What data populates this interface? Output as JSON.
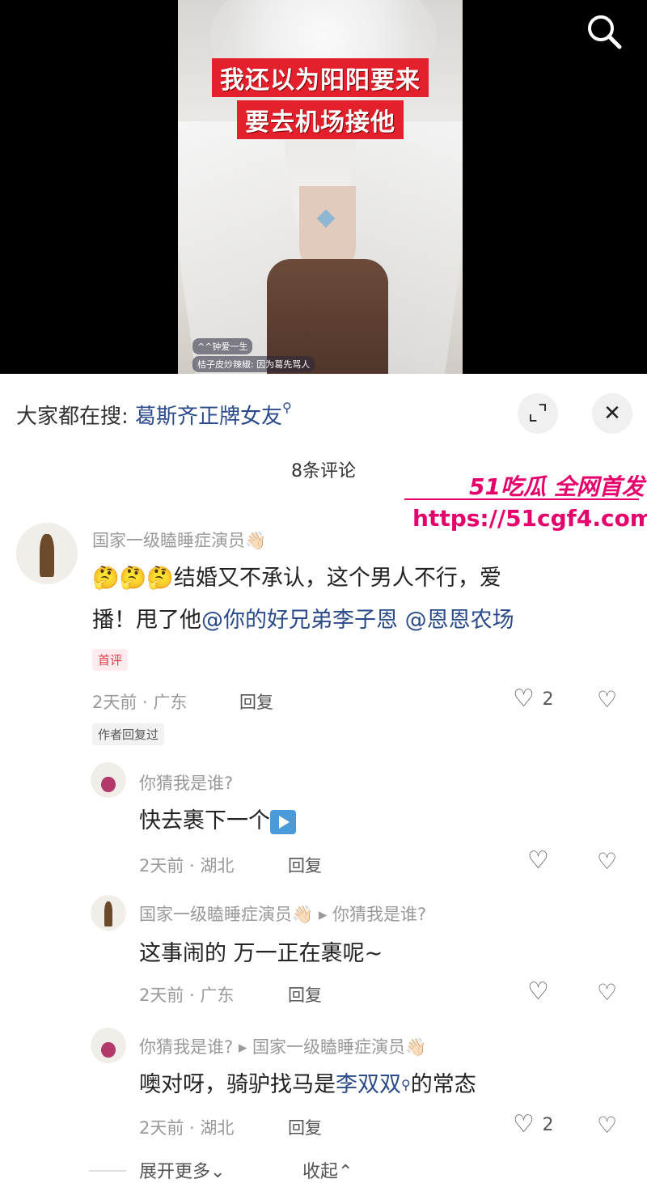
{
  "video": {
    "caption_line1": "我还以为阳阳要来",
    "caption_line2": "要去机场接他",
    "live_msg1": "^^钟爱一生",
    "live_msg2": "桔子皮炒辣椒: 因为葛先骂人"
  },
  "search_bar": {
    "prefix": "大家都在搜:",
    "query": "葛斯齐正牌女友",
    "query_icon": "search-icon",
    "expand_icon": "expand-icon",
    "close_icon": "close-icon"
  },
  "comment_count": "8条评论",
  "watermark": {
    "brand": "51吃瓜 全网首发",
    "url": "https://51cgf4.com"
  },
  "comments": [
    {
      "name": "国家一级瞌睡症演员👋🏻",
      "text_pre": "🤔🤔🤔结婚又不承认，这个男人不行，爱",
      "text_line2": "播！甩了他",
      "mention1": "@你的好兄弟李子恩",
      "mention2": "@恩恩农场",
      "tag_first": "首评",
      "time_loc": "2天前 · 广东",
      "reply": "回复",
      "likes": "2",
      "tag_author": "作者回复过"
    },
    {
      "name": "你猜我是谁?",
      "text": "快去裹下一个",
      "time_loc": "2天前 · 湖北",
      "reply": "回复"
    },
    {
      "name": "国家一级瞌睡症演员👋🏻",
      "reply_to": "▸ 你猜我是谁?",
      "text": "这事闹的 万一正在裹呢~",
      "time_loc": "2天前 · 广东",
      "reply": "回复"
    },
    {
      "name": "你猜我是谁?",
      "reply_to": "▸ 国家一级瞌睡症演员👋🏻",
      "text_pre": "噢对呀，骑驴找马是",
      "link": "李双双",
      "text_post": "的常态",
      "time_loc": "2天前 · 湖北",
      "reply": "回复",
      "likes": "2"
    }
  ],
  "footer": {
    "expand_more": "展开更多⌄",
    "collapse": "收起⌃"
  }
}
